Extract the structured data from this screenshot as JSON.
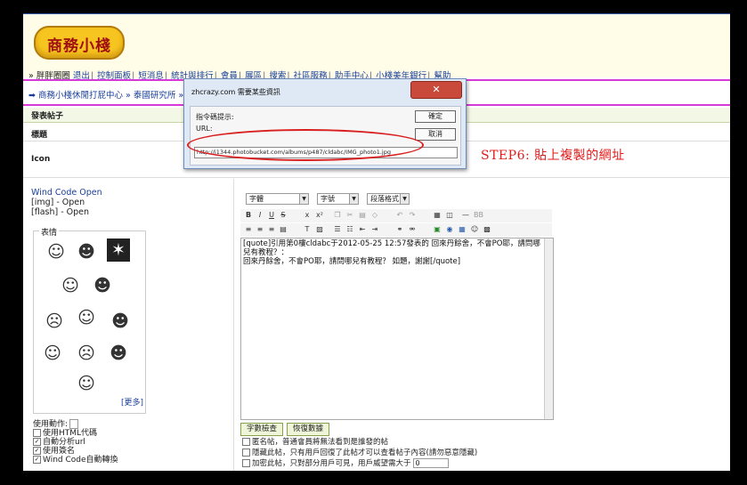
{
  "logo": {
    "text": "商務小棧"
  },
  "nav": {
    "user": "» 胖胖圈圈",
    "links": [
      "退出",
      "控制面板",
      "短消息",
      "統計與排行",
      "會員",
      "展區",
      "搜索",
      "社區服務",
      "助手中心",
      "小棧美年銀行",
      "幫助"
    ]
  },
  "breadcrumb": {
    "text": "➡ 商務小棧休閒打屁中心 » 泰國研究所 » 回"
  },
  "post": {
    "section_title": "發表帖子",
    "title_label": "標題",
    "icon_label": "Icon"
  },
  "wind": {
    "title": "Wind Code Open",
    "img": "[img] - Open",
    "flash": "[flash] - Open"
  },
  "smilies": {
    "label": "表情",
    "more": "[更多]"
  },
  "options": {
    "use_action": "使用動作:",
    "items": [
      "使用HTML代碼",
      "自動分析url",
      "使用簽名",
      "Wind Code自動轉換"
    ]
  },
  "editor": {
    "font": "字體",
    "size": "字號",
    "format": "段落格式",
    "content": "[quote]引用第0樓cldabc于2012-05-25 12:57發表的 回來丹餘舍，不會PO耶，請問哪兒有教程？：\n回來丹餘舍，不會PO耶，請問哪兒有教程？ 如題，謝謝[/quote]"
  },
  "buttons": {
    "count": "字數檢查",
    "restore": "恢復數據"
  },
  "checks": [
    "匿名帖，普通會員將無法看到是誰發的帖",
    "隱藏此帖，只有用戶回復了此帖才可以查看帖子內容(請勿惡意隱藏)",
    "加密此帖，只對部分用戶可見，用戶威望需大于"
  ],
  "checks_value": "0",
  "annotation": {
    "text": "STEP6: 貼上複製的網址"
  },
  "dialog": {
    "title": "zhcrazy.com 需要某些資訊",
    "close": "✕",
    "prompt": "指令碼提示:",
    "url_label": "URL:",
    "ok": "確定",
    "cancel": "取消",
    "url_value": "http://i1344.photobucket.com/albums/p487/cldabc/IMG_photo1.jpg"
  },
  "colors": {
    "accent_line": "#d63ad6",
    "link": "#1a3f9a",
    "annotation": "#e21a1a"
  }
}
